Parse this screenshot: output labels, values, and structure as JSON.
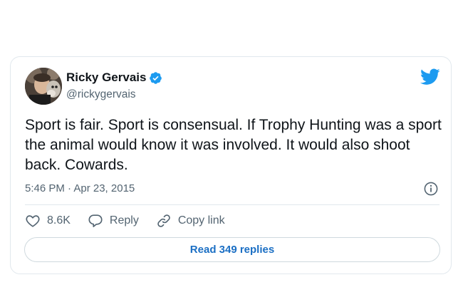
{
  "author": {
    "display_name": "Ricky Gervais",
    "handle": "@rickygervais",
    "verified": true,
    "avatar_icon": "profile-photo-with-dog"
  },
  "brand": {
    "icon": "twitter-bird-icon",
    "color": "#1d9bf0"
  },
  "tweet": {
    "text": "Sport is fair. Sport is consensual. If Trophy Hunting was a sport the animal would know it was involved. It would also shoot back. Cowards.",
    "timestamp": "5:46 PM · Apr 23, 2015"
  },
  "actions": {
    "like_count": "8.6K",
    "reply_label": "Reply",
    "copy_link_label": "Copy link"
  },
  "read_replies_label": "Read 349 replies",
  "colors": {
    "text": "#0f1419",
    "secondary": "#536471",
    "border": "#e1e8ed",
    "link": "#1b6fc4"
  }
}
